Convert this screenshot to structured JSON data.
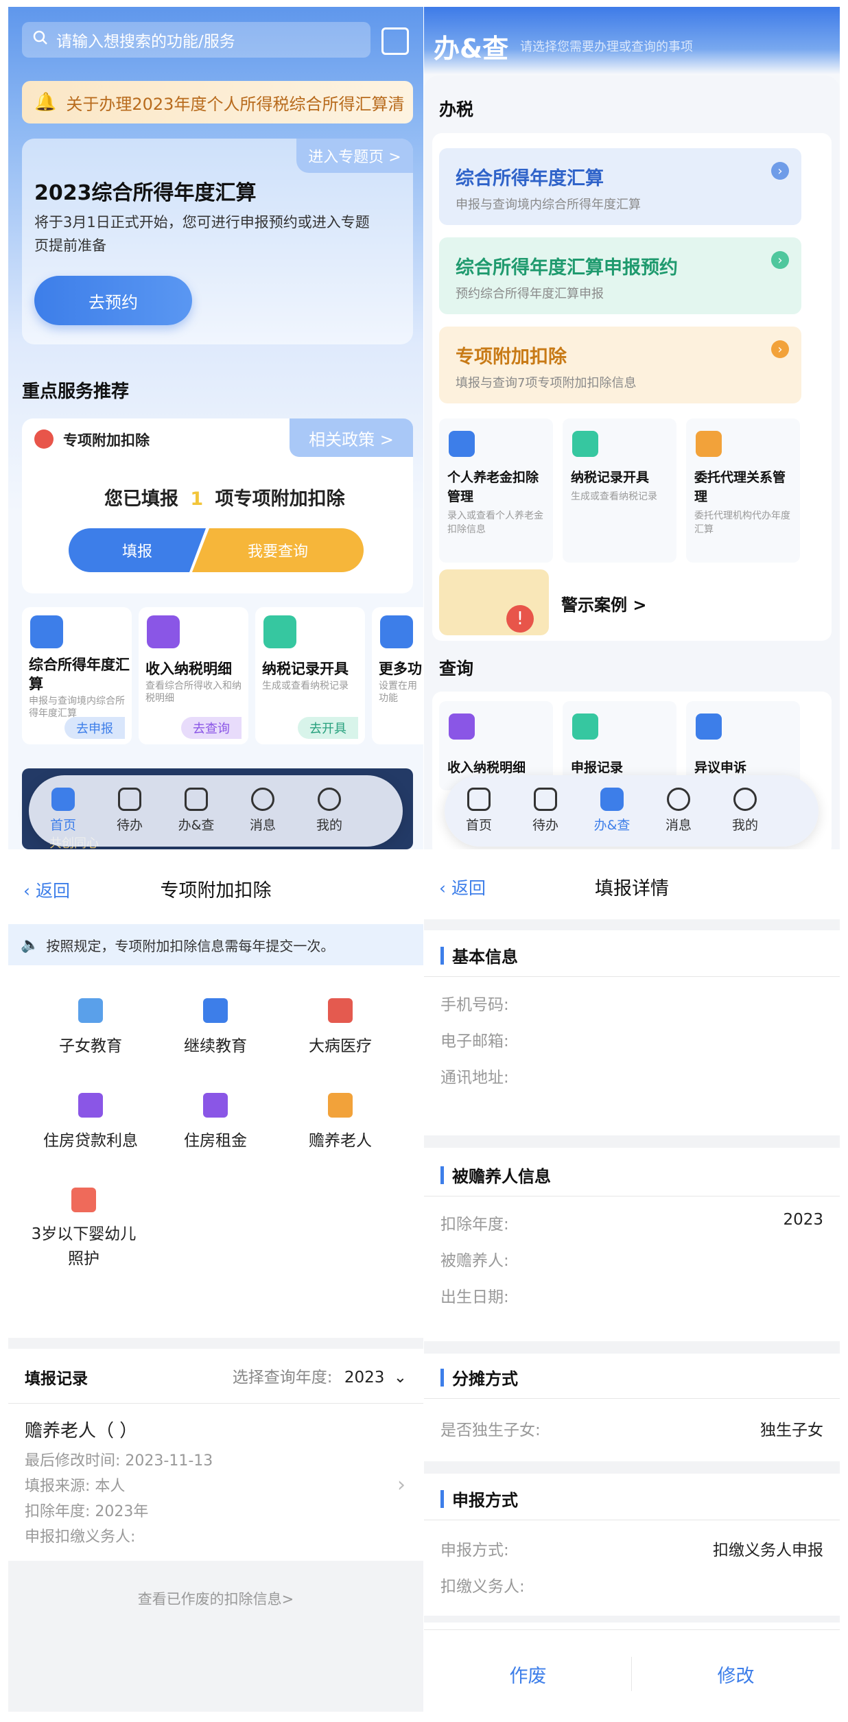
{
  "home": {
    "search_placeholder": "请输入想搜索的功能/服务",
    "notice": "关于办理2023年度个人所得税综合所得汇算清",
    "banner": {
      "tag": "进入专题页 >",
      "title": "2023综合所得年度汇算",
      "desc": "将于3月1日正式开始，您可进行申报预约或进入专题页提前准备",
      "button": "去预约"
    },
    "section_title": "重点服务推荐",
    "deduction_card": {
      "name": "专项附加扣除",
      "policy": "相关政策 >",
      "stat_prefix": "您已填报",
      "stat_count": "1",
      "stat_suffix": "项专项附加扣除",
      "btn_fill": "填报",
      "btn_query": "我要查询"
    },
    "services": [
      {
        "title": "综合所得年度汇算",
        "desc": "申报与查询境内综合所得年度汇算",
        "action": "去申报",
        "color": "#3d7ee9"
      },
      {
        "title": "收入纳税明细",
        "desc": "查看综合所得收入和纳税明细",
        "action": "去查询",
        "color": "#8a56e6"
      },
      {
        "title": "纳税记录开具",
        "desc": "生成或查看纳税记录",
        "action": "去开具",
        "color": "#36c7a0"
      },
      {
        "title": "更多功",
        "desc": "设置在用功能",
        "action": "",
        "color": "#3d7ee9"
      }
    ],
    "tabs": [
      "首页",
      "待办",
      "办&查",
      "消息",
      "我的"
    ],
    "bottom_peek": "共创同心"
  },
  "banzha": {
    "title": "办&查",
    "subtitle": "请选择您需要办理或查询的事项",
    "tax_section": "办税",
    "cards": [
      {
        "title": "综合所得年度汇算",
        "desc": "申报与查询境内综合所得年度汇算",
        "bg": "#e6eefb",
        "fg": "#2f63c9"
      },
      {
        "title": "综合所得年度汇算申报预约",
        "desc": "预约综合所得年度汇算申报",
        "bg": "#e3f6ef",
        "fg": "#1f9a6e"
      },
      {
        "title": "专项附加扣除",
        "desc": "填报与查询7项专项附加扣除信息",
        "bg": "#fdf1dd",
        "fg": "#c87a16"
      }
    ],
    "squares": [
      {
        "title": "个人养老金扣除管理",
        "desc": "录入或查看个人养老金扣除信息",
        "color": "#3d7ee9"
      },
      {
        "title": "纳税记录开具",
        "desc": "生成或查看纳税记录",
        "color": "#36c7a0"
      },
      {
        "title": "委托代理关系管理",
        "desc": "委托代理机构代办年度汇算",
        "color": "#f2a23a"
      }
    ],
    "warning": "警示案例 >",
    "query_section": "查询",
    "queries": [
      "收入纳税明细",
      "申报记录",
      "异议申诉"
    ],
    "tabs": [
      "首页",
      "待办",
      "办&查",
      "消息",
      "我的"
    ]
  },
  "deduction": {
    "back": "返回",
    "title": "专项附加扣除",
    "tip": "按照规定，专项附加扣除信息需每年提交一次。",
    "categories": [
      {
        "label": "子女教育",
        "color": "#5aa0ea"
      },
      {
        "label": "继续教育",
        "color": "#3d7ee9"
      },
      {
        "label": "大病医疗",
        "color": "#e45a4f"
      },
      {
        "label": "住房贷款利息",
        "color": "#8a56e6"
      },
      {
        "label": "住房租金",
        "color": "#8a56e6"
      },
      {
        "label": "赡养老人",
        "color": "#f2a23a"
      },
      {
        "label": "3岁以下婴幼儿照护",
        "color": "#ef6a5a"
      }
    ],
    "records_title": "填报记录",
    "year_label": "选择查询年度:",
    "year_value": "2023",
    "record": {
      "name": "赡养老人（            ）",
      "modified": "最后修改时间:  2023-11-13",
      "source": "填报来源:  本人",
      "year": "扣除年度:  2023年",
      "agent": "申报扣缴义务人:"
    },
    "voided_link": "查看已作废的扣除信息>"
  },
  "detail": {
    "back": "返回",
    "title": "填报详情",
    "basic": {
      "title": "基本信息",
      "rows": [
        {
          "label": "手机号码:",
          "value": ""
        },
        {
          "label": "电子邮箱:",
          "value": ""
        },
        {
          "label": "通讯地址:",
          "value": ""
        }
      ]
    },
    "supported": {
      "title": "被赡养人信息",
      "rows": [
        {
          "label": "扣除年度:",
          "value": "2023"
        },
        {
          "label": "被赡养人:",
          "value": ""
        },
        {
          "label": "出生日期:",
          "value": ""
        }
      ]
    },
    "split": {
      "title": "分摊方式",
      "rows": [
        {
          "label": "是否独生子女:",
          "value": "独生子女"
        }
      ]
    },
    "declare": {
      "title": "申报方式",
      "rows": [
        {
          "label": "申报方式:",
          "value": "扣缴义务人申报"
        },
        {
          "label": "扣缴义务人:",
          "value": ""
        }
      ]
    },
    "void_btn": "作废",
    "edit_btn": "修改"
  }
}
